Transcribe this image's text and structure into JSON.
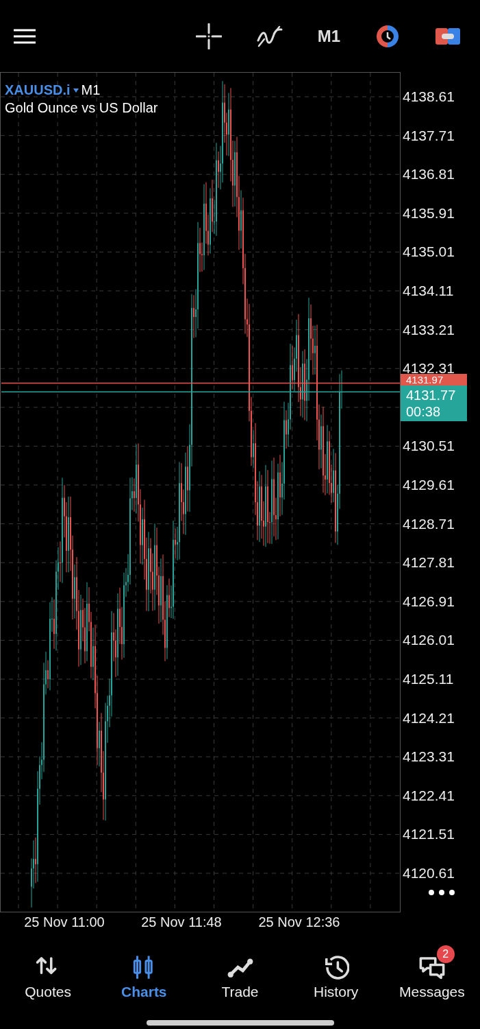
{
  "top_bar": {
    "timeframe": "M1"
  },
  "chart": {
    "symbol": "XAUUSD.i",
    "timeframe": "M1",
    "description": "Gold Ounce vs US Dollar",
    "price_labels": [
      "4138.61",
      "4137.71",
      "4136.81",
      "4135.91",
      "4135.01",
      "4134.11",
      "4133.21",
      "4132.31",
      "4130.51",
      "4129.61",
      "4128.71",
      "4127.81",
      "4126.91",
      "4126.01",
      "4125.11",
      "4124.21",
      "4123.31",
      "4122.41",
      "4121.51",
      "4120.61"
    ],
    "bid_tag": "4131.97",
    "ask_tag": {
      "price": "4131.77",
      "countdown": "00:38"
    },
    "time_labels": [
      "25 Nov 11:00",
      "25 Nov 11:48",
      "25 Nov 12:36"
    ]
  },
  "nav": [
    {
      "kind": "quotes",
      "label": "Quotes",
      "selected": false
    },
    {
      "kind": "charts",
      "label": "Charts",
      "selected": true
    },
    {
      "kind": "trade",
      "label": "Trade",
      "selected": false
    },
    {
      "kind": "history",
      "label": "History",
      "selected": false
    },
    {
      "kind": "messages",
      "label": "Messages",
      "selected": false,
      "badge": "2"
    }
  ]
}
